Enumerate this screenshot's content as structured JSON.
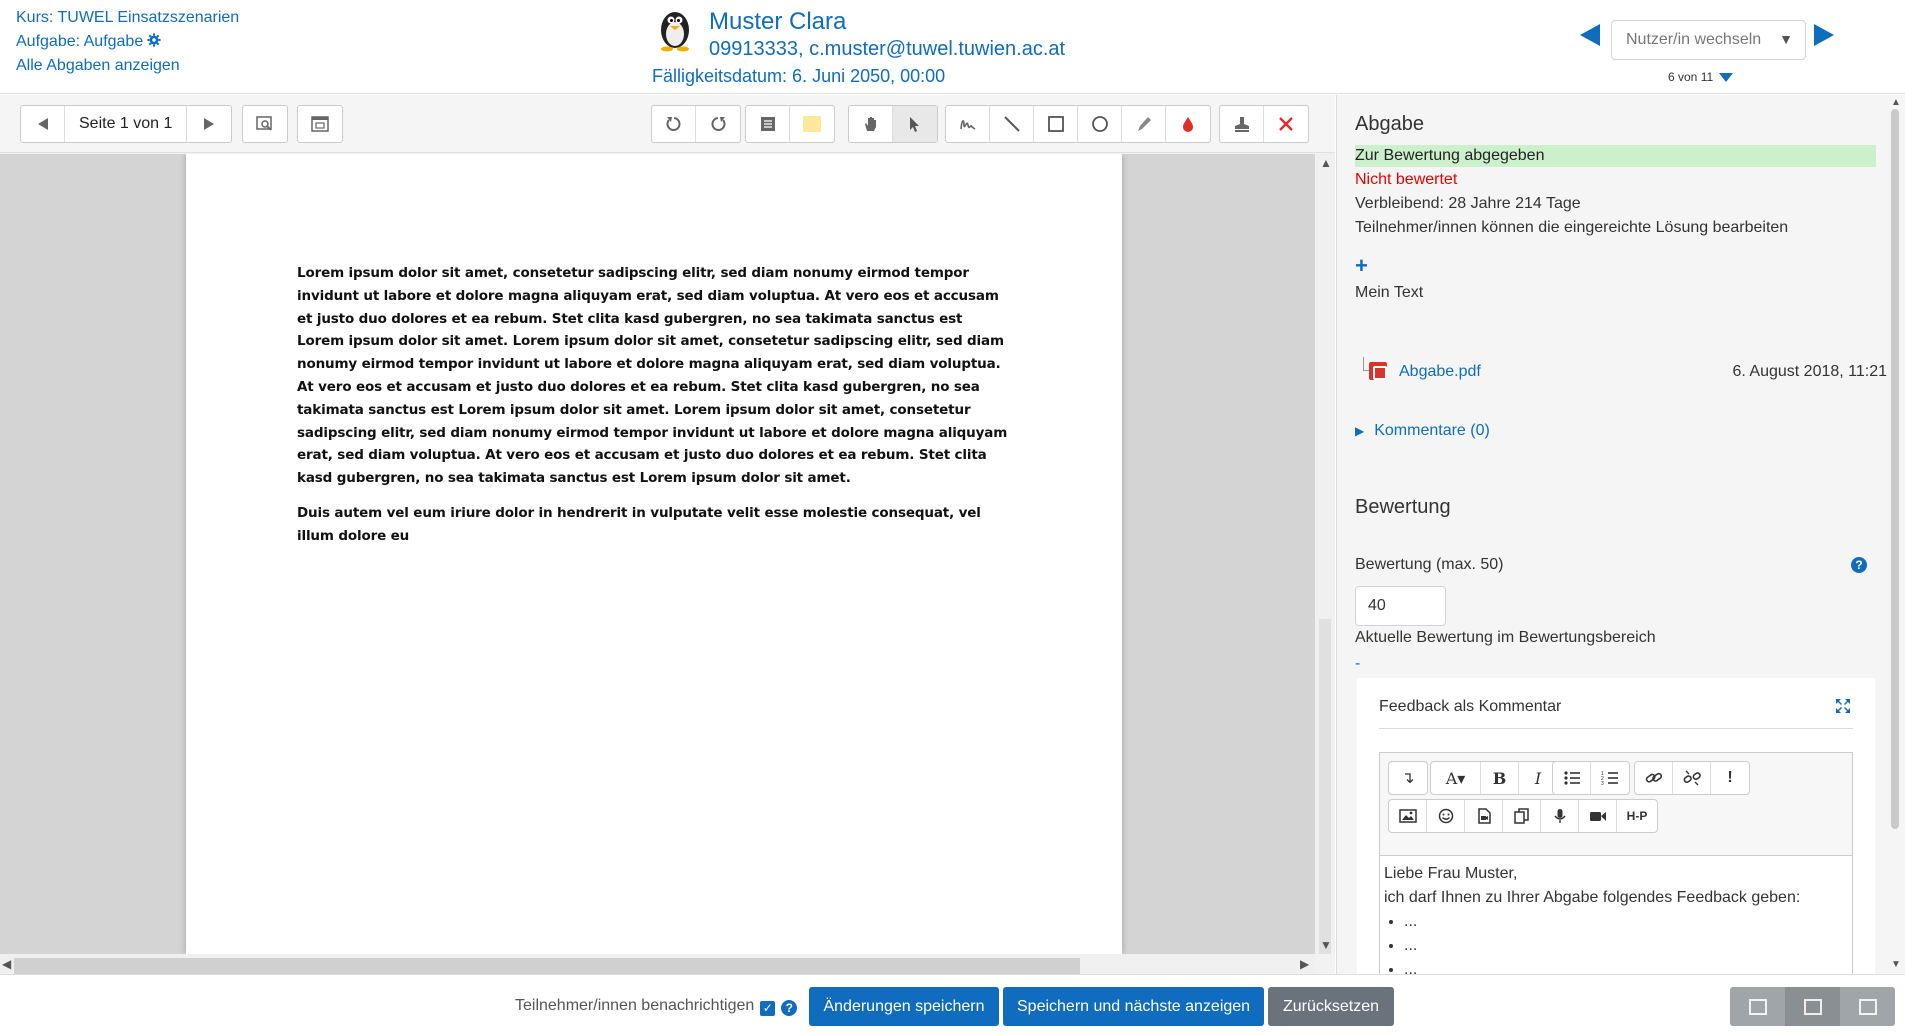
{
  "header": {
    "course": "Kurs: TUWEL Einsatzszenarien",
    "assignment_prefix": "Aufgabe: Aufgabe",
    "all_submissions": "Alle Abgaben anzeigen",
    "user_name": "Muster Clara",
    "user_id_email": "09913333, c.muster@tuwel.tuwien.ac.at",
    "due_date": "Fälligkeitsdatum: 6. Juni 2050, 00:00",
    "user_switch_placeholder": "Nutzer/in wechseln",
    "count": "6 von 11"
  },
  "pdf_toolbar": {
    "page_label": "Seite 1 von 1"
  },
  "document": {
    "paragraph1": "Lorem ipsum dolor sit amet, consetetur sadipscing elitr, sed diam nonumy eirmod tempor invidunt ut labore et dolore magna aliquyam erat, sed diam voluptua. At vero eos et accusam et justo duo dolores et ea rebum. Stet clita kasd gubergren, no sea takimata sanctus est Lorem ipsum dolor sit amet. Lorem ipsum dolor sit amet, consetetur sadipscing elitr, sed diam nonumy eirmod tempor invidunt ut labore et dolore magna aliquyam erat, sed diam voluptua. At vero eos et accusam et justo duo dolores et ea rebum. Stet clita kasd gubergren, no sea takimata sanctus est Lorem ipsum dolor sit amet. Lorem ipsum dolor sit amet, consetetur sadipscing elitr, sed diam nonumy eirmod tempor invidunt ut labore et dolore magna aliquyam erat, sed diam voluptua. At vero eos et accusam et justo duo dolores et ea rebum. Stet clita kasd gubergren, no sea takimata sanctus est Lorem ipsum dolor sit amet.",
    "paragraph2": "Duis autem vel eum iriure dolor in hendrerit in vulputate velit esse molestie consequat, vel illum dolore eu"
  },
  "submission": {
    "heading": "Abgabe",
    "status_submitted": "Zur Bewertung abgegeben",
    "status_grading": "Nicht bewertet",
    "remaining": "Verbleibend: 28 Jahre 214 Tage",
    "can_edit": "Teilnehmer/innen können die eingereichte Lösung bearbeiten",
    "my_text": "Mein Text",
    "file_name": "Abgabe.pdf",
    "file_date": "6. August 2018, 11:21",
    "comments": "Kommentare (0)"
  },
  "grading": {
    "heading": "Bewertung",
    "grade_label": "Bewertung (max. 50)",
    "grade_value": "40",
    "current_grade_label": "Aktuelle Bewertung im Bewertungsbereich",
    "current_grade_value": "-",
    "feedback_title": "Feedback als Kommentar",
    "feedback_line1": "Liebe Frau Muster,",
    "feedback_line2": "ich darf Ihnen zu Ihrer Abgabe folgendes Feedback geben:",
    "bullet1": "...",
    "bullet2": "...",
    "bullet3": "...",
    "h5p_label": "H-P"
  },
  "footer": {
    "notify_label": "Teilnehmer/innen benachrichtigen",
    "save_button": "Änderungen speichern",
    "save_next_button": "Speichern und nächste anzeigen",
    "reset_button": "Zurücksetzen"
  },
  "colors": {
    "accent": "#0f6cbf",
    "status_green_bg": "#cdf0cc",
    "status_red": "#ee0000"
  }
}
